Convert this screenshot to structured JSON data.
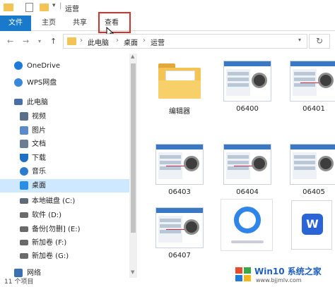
{
  "titlebar": {
    "title": "运营",
    "separator": "|"
  },
  "ribbon": {
    "tabs": [
      "文件",
      "主页",
      "共享",
      "查看"
    ]
  },
  "address": {
    "path": [
      "此电脑",
      "桌面",
      "运营"
    ],
    "sep": "›"
  },
  "nav": {
    "items": [
      {
        "label": "OneDrive",
        "icon": "cloud-icon",
        "color": "#1d7ad6"
      },
      {
        "label": "WPS网盘",
        "icon": "wps-cloud-icon",
        "color": "#3a86d8"
      },
      {
        "label": "此电脑",
        "icon": "computer-icon",
        "color": "#4a6fa5"
      },
      {
        "label": "视频",
        "icon": "video-folder-icon",
        "color": "#5a6f8a"
      },
      {
        "label": "图片",
        "icon": "pictures-folder-icon",
        "color": "#5a8ac8"
      },
      {
        "label": "文档",
        "icon": "documents-folder-icon",
        "color": "#6b7c93"
      },
      {
        "label": "下载",
        "icon": "download-arrow-icon",
        "color": "#1f6fc5"
      },
      {
        "label": "音乐",
        "icon": "music-note-icon",
        "color": "#2a7bd0"
      },
      {
        "label": "桌面",
        "icon": "desktop-icon",
        "color": "#2b8ee6"
      },
      {
        "label": "本地磁盘 (C:)",
        "icon": "windows-drive-icon",
        "color": "#5f6b7a"
      },
      {
        "label": "软件 (D:)",
        "icon": "drive-icon",
        "color": "#6a6a6a"
      },
      {
        "label": "备份[勿删] (E:)",
        "icon": "drive-icon",
        "color": "#6a6a6a"
      },
      {
        "label": "新加卷 (F:)",
        "icon": "drive-icon",
        "color": "#6a6a6a"
      },
      {
        "label": "新加卷 (G:)",
        "icon": "drive-icon",
        "color": "#6a6a6a"
      },
      {
        "label": "网络",
        "icon": "network-icon",
        "color": "#3b6fb0"
      }
    ]
  },
  "files": [
    {
      "name": "编辑器",
      "type": "folder"
    },
    {
      "name": "06400",
      "type": "image"
    },
    {
      "name": "06401",
      "type": "image"
    },
    {
      "name": "06403",
      "type": "image"
    },
    {
      "name": "06404",
      "type": "image"
    },
    {
      "name": "06405",
      "type": "image"
    },
    {
      "name": "06407",
      "type": "image"
    },
    {
      "name": "",
      "type": "app-image"
    },
    {
      "name": "",
      "type": "word-document"
    }
  ],
  "status": {
    "count": "11 个项目"
  },
  "watermark": {
    "brand": "Win10 系统之家",
    "url": "www.bjjmlv.com"
  },
  "colors": {
    "accent": "#1979ca",
    "highlight_box": "#d6322b",
    "selection": "#cde8ff",
    "folder": "#f3c454"
  }
}
